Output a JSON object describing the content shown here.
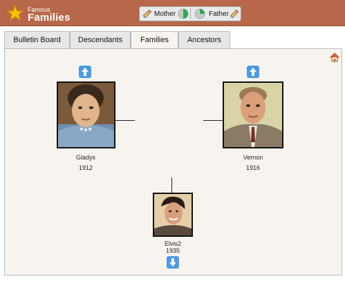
{
  "app": {
    "brand_small": "Famous",
    "brand_big": "Families"
  },
  "toggles": {
    "mother_label": "Mother",
    "father_label": "Father"
  },
  "tabs": [
    {
      "label": "Bulletin Board"
    },
    {
      "label": "Descendants"
    },
    {
      "label": "Families"
    },
    {
      "label": "Ancestors"
    }
  ],
  "active_tab": "Families",
  "family": {
    "mother": {
      "name": "Gladys",
      "year": "1912"
    },
    "father": {
      "name": "Vernon",
      "year": "1916"
    },
    "child": {
      "name": "Elvis2",
      "year": "1935"
    }
  },
  "colors": {
    "header": "#b8684a",
    "arrow_button": "#4a9ae6",
    "panel": "#f7f3ee",
    "pie_green": "#2fa84f"
  },
  "icons": [
    "star-icon",
    "pencil-icon",
    "pie-chart-icon",
    "home-icon",
    "arrow-up-icon",
    "arrow-down-icon"
  ]
}
